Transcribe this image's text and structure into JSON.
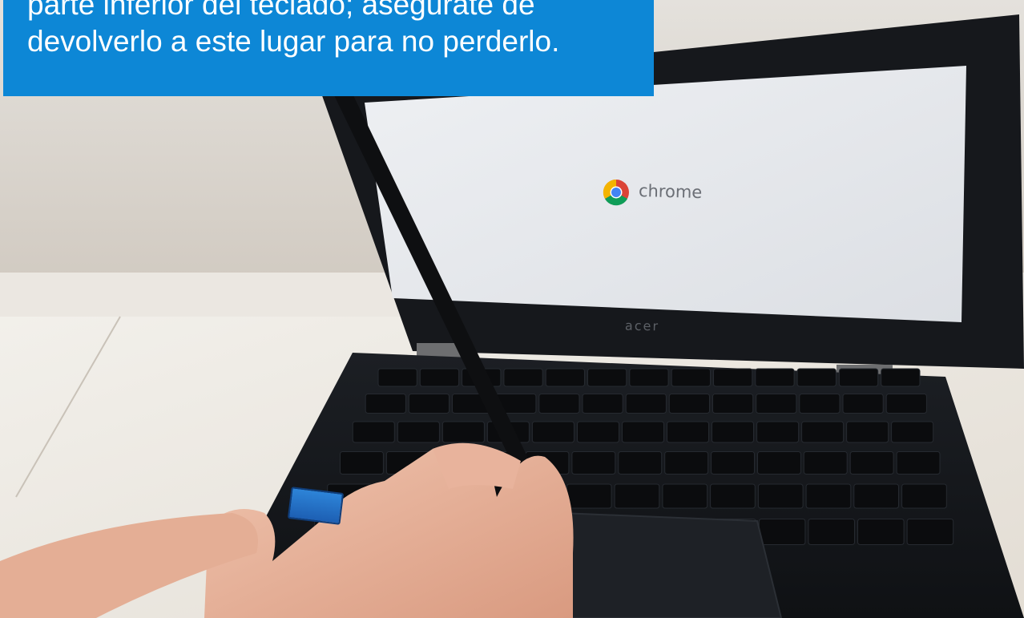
{
  "caption": {
    "line1": "parte inferior del teclado; asegúrate de",
    "line2": "devolverlo a este lugar para no perderlo."
  },
  "screen": {
    "logo_icon": "chrome-logo-icon",
    "brand_text": "chrome"
  },
  "laptop": {
    "brand_text": "acer"
  },
  "colors": {
    "caption_bg": "#0d87d6",
    "caption_text": "#ffffff",
    "screen_bg": "#e3e6ea"
  }
}
